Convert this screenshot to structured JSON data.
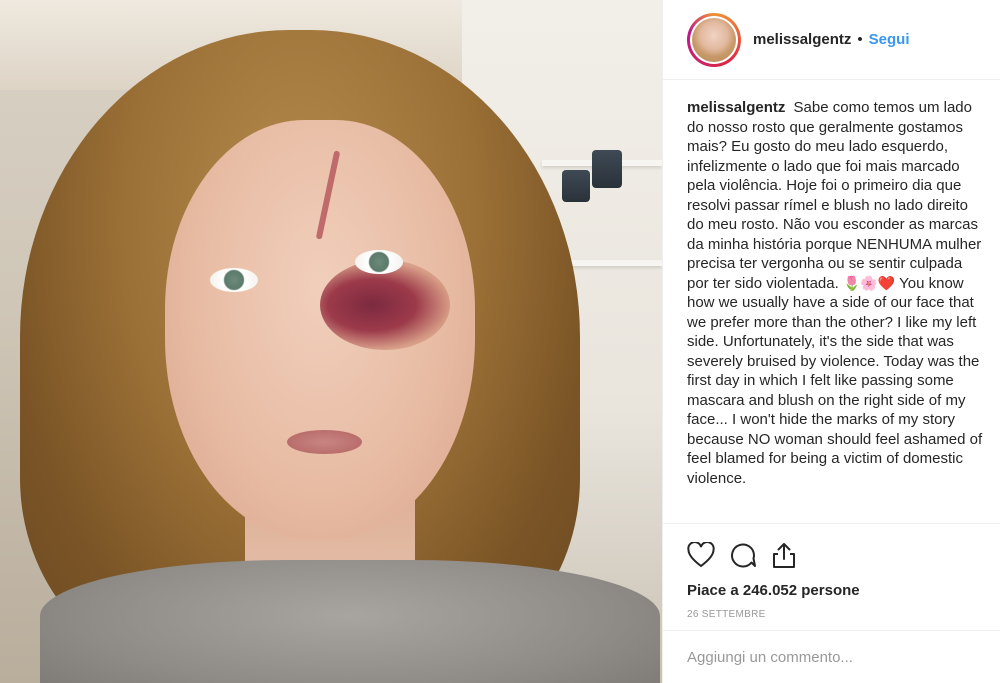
{
  "post": {
    "author": {
      "username": "melissalgentz",
      "separator": "•",
      "follow_label": "Segui"
    },
    "caption": {
      "text_pt": "Sabe como temos um lado do nosso rosto que geralmente gostamos mais? Eu gosto do meu lado esquerdo, infelizmente o lado que foi mais marcado pela violência. Hoje foi o primeiro dia que resolvi passar rímel e blush no lado direito do meu rosto. Não vou esconder as marcas da minha história porque NENHUMA mulher precisa ter vergonha ou se sentir culpada por ter sido violentada.",
      "emojis": "🌷🌸❤️",
      "text_en": "You know how we usually have a side of our face that we prefer more than the other? I like my left side. Unfortunately, it's the side that was severely bruised by violence. Today was the first day in which I felt like passing some mascara and blush on the right side of my face... I won't hide the marks of my story because NO woman should feel ashamed of feel blamed for being a victim of domestic violence."
    },
    "likes_text": "Piace a 246.052 persone",
    "date": "26 SETTEMBRE",
    "comment_placeholder": "Aggiungi un commento...",
    "icons": [
      "heart-icon",
      "comment-icon",
      "share-icon"
    ],
    "colors": {
      "link": "#3897f0",
      "text": "#262626",
      "muted": "#999999",
      "border": "#efefef"
    }
  }
}
